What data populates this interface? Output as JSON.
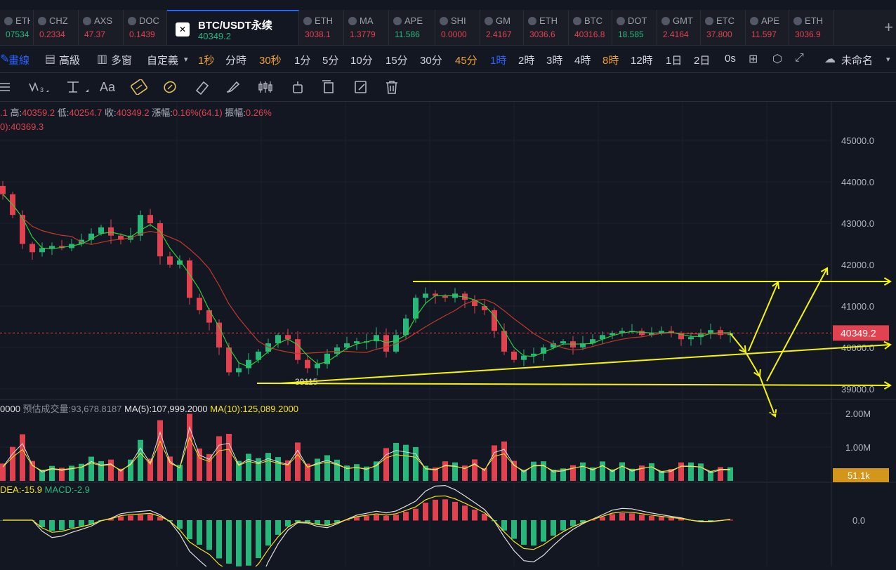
{
  "tickers": [
    {
      "name": "ETH",
      "price": "07534",
      "up": true
    },
    {
      "name": "CHZ",
      "price": "0.2334",
      "up": false
    },
    {
      "name": "AXS",
      "price": "47.37",
      "up": false
    },
    {
      "name": "DOC",
      "price": "0.1439",
      "up": false
    },
    {
      "name": "BTC/USDT永续",
      "price": "40349.2",
      "up": true,
      "active": true
    },
    {
      "name": "ETH",
      "price": "3038.1",
      "up": false
    },
    {
      "name": "MA",
      "price": "1.3779",
      "up": false
    },
    {
      "name": "APE",
      "price": "11.586",
      "up": true
    },
    {
      "name": "SHI",
      "price": "0.0000",
      "up": false
    },
    {
      "name": "GM",
      "price": "2.4167",
      "up": false
    },
    {
      "name": "ETH",
      "price": "3036.6",
      "up": false
    },
    {
      "name": "BTC",
      "price": "40316.8",
      "up": false
    },
    {
      "name": "DOT",
      "price": "18.585",
      "up": true
    },
    {
      "name": "GMT",
      "price": "2.4164",
      "up": false
    },
    {
      "name": "ETC",
      "price": "37.800",
      "up": false
    },
    {
      "name": "APE",
      "price": "11.597",
      "up": false
    },
    {
      "name": "ETH",
      "price": "3036.9",
      "up": false
    }
  ],
  "toolbar": {
    "draw_line": "畫線",
    "advanced": "高級",
    "multi_window": "多窗",
    "custom": "自定義",
    "timeframes": [
      "1秒",
      "分時",
      "30秒",
      "1分",
      "5分",
      "10分",
      "15分",
      "30分",
      "45分",
      "1時",
      "2時",
      "3時",
      "4時",
      "8時",
      "12時",
      "1日",
      "2日",
      "0s"
    ],
    "timeframe_active": "1時",
    "layout_name": "未命名"
  },
  "ohlc": {
    "open_tail": ".1",
    "high_label": "高:",
    "high": "40359.2",
    "low_label": "低:",
    "low": "40254.7",
    "close_label": "收:",
    "close": "40349.2",
    "change_label": "漲幅:",
    "change": "0.16%(64.1)",
    "amp_label": "振幅:",
    "amp": "0.26%",
    "ma_line": "0):40369.3"
  },
  "volume_info": {
    "vol": "0000",
    "est_label": "预估成交量:",
    "est": "93,678.8187",
    "ma5": "MA(5):107,999.2000",
    "ma10": "MA(10):125,089.2000"
  },
  "macd_info": {
    "dea": "DEA:-15.9",
    "macd": "MACD:-2.9"
  },
  "colors": {
    "up": "#28b67a",
    "down": "#e0434f",
    "accent": "#2962ff",
    "drawing": "#f5f50a",
    "price_tag": "#e0434f",
    "vol_tag": "#d4951b"
  },
  "chart_data": {
    "type": "candlestick",
    "symbol": "BTC/USDT永续",
    "interval": "1時",
    "y_ticks": [
      "45000.0",
      "44000.0",
      "43000.0",
      "42000.0",
      "41000.0",
      "40000.0",
      "39000.0"
    ],
    "ylim": [
      38750,
      45400
    ],
    "current_price": "40349.2",
    "low_annotation": "39115",
    "closes": [
      43700,
      43200,
      42500,
      42300,
      42400,
      42450,
      42400,
      42500,
      42600,
      42750,
      42900,
      42700,
      42600,
      42700,
      43200,
      43000,
      42200,
      42000,
      42100,
      41200,
      40900,
      40600,
      40000,
      39400,
      39500,
      39700,
      39900,
      40100,
      40300,
      40200,
      39700,
      39500,
      39600,
      39850,
      40000,
      40100,
      40150,
      40150,
      40300,
      39900,
      40300,
      40700,
      41200,
      41300,
      41250,
      41200,
      41300,
      41150,
      41000,
      40900,
      40400,
      39900,
      39700,
      39800,
      39850,
      40000,
      40100,
      40150,
      40000,
      40100,
      40200,
      40300,
      40350,
      40400,
      40400,
      40300,
      40350,
      40400,
      40350,
      40200,
      40250,
      40350,
      40420,
      40300,
      40350
    ],
    "volume_y_ticks": [
      "2.00M",
      "1.00M"
    ],
    "volume_tag": "51.1k",
    "macd_y_ticks": [
      "0.0"
    ]
  }
}
